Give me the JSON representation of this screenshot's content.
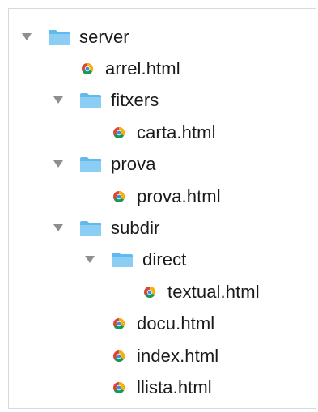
{
  "tree": {
    "nodes": [
      {
        "type": "folder",
        "label": "server",
        "expanded": true,
        "level": 0
      },
      {
        "type": "file",
        "label": "arrel.html",
        "level": 0
      },
      {
        "type": "folder",
        "label": "fitxers",
        "expanded": true,
        "level": 1
      },
      {
        "type": "file",
        "label": "carta.html",
        "level": 1
      },
      {
        "type": "folder",
        "label": "prova",
        "expanded": true,
        "level": 1
      },
      {
        "type": "file",
        "label": "prova.html",
        "level": 1
      },
      {
        "type": "folder",
        "label": "subdir",
        "expanded": true,
        "level": 1
      },
      {
        "type": "folder",
        "label": "direct",
        "expanded": true,
        "level": 2
      },
      {
        "type": "file",
        "label": "textual.html",
        "level": 3
      },
      {
        "type": "file",
        "label": "docu.html",
        "level": 2
      },
      {
        "type": "file",
        "label": "index.html",
        "level": 2
      },
      {
        "type": "file",
        "label": "llista.html",
        "level": 2
      }
    ]
  },
  "colors": {
    "folder": "#62b9ee",
    "folder_tab": "#8ccdf3",
    "disclosure": "#8e8e8e",
    "text": "#1a1a1a",
    "border": "#d9d9d9"
  },
  "icons": {
    "folder": "folder-icon",
    "file": "chrome-file-icon",
    "disclosure": "disclosure-triangle-down-icon"
  }
}
